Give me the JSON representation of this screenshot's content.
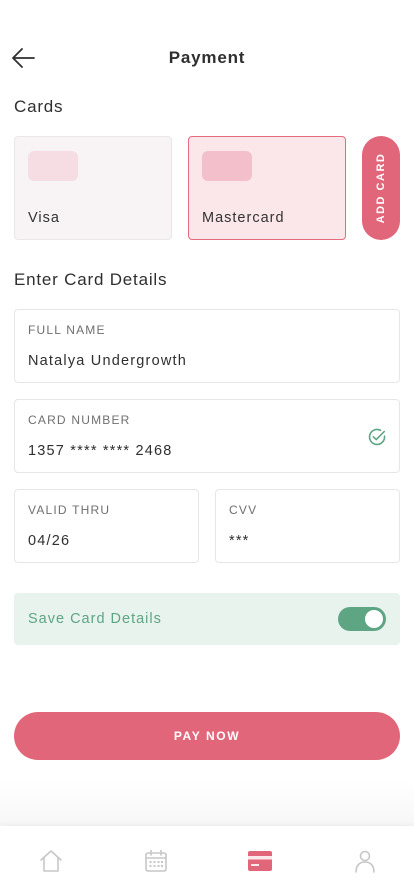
{
  "header": {
    "title": "Payment",
    "back_icon": "arrow-left-icon"
  },
  "cards_section": {
    "title": "Cards",
    "cards": [
      {
        "label": "Visa",
        "selected": false
      },
      {
        "label": "Mastercard",
        "selected": true
      }
    ],
    "add_card_label": "ADD CARD"
  },
  "details_section": {
    "title": "Enter Card Details",
    "full_name": {
      "label": "FULL NAME",
      "value": "Natalya Undergrowth"
    },
    "card_number": {
      "label": "CARD NUMBER",
      "value": "1357 **** **** 2468",
      "valid_icon": "check-circle-icon"
    },
    "valid_thru": {
      "label": "VALID THRU",
      "value": "04/26"
    },
    "cvv": {
      "label": "CVV",
      "value": "***"
    }
  },
  "save_card": {
    "label": "Save Card Details",
    "enabled": true
  },
  "pay_button": {
    "label": "PAY NOW"
  },
  "bottom_nav": {
    "items": [
      {
        "icon": "home-icon",
        "active": false
      },
      {
        "icon": "calendar-icon",
        "active": false
      },
      {
        "icon": "credit-card-icon",
        "active": true
      },
      {
        "icon": "profile-icon",
        "active": false
      }
    ]
  },
  "colors": {
    "accent": "#e2667a",
    "success": "#5ea584",
    "success_bg": "#e8f3ee",
    "selected_card_bg": "#fbe7ea",
    "inactive_icon": "#c7c7c7"
  }
}
